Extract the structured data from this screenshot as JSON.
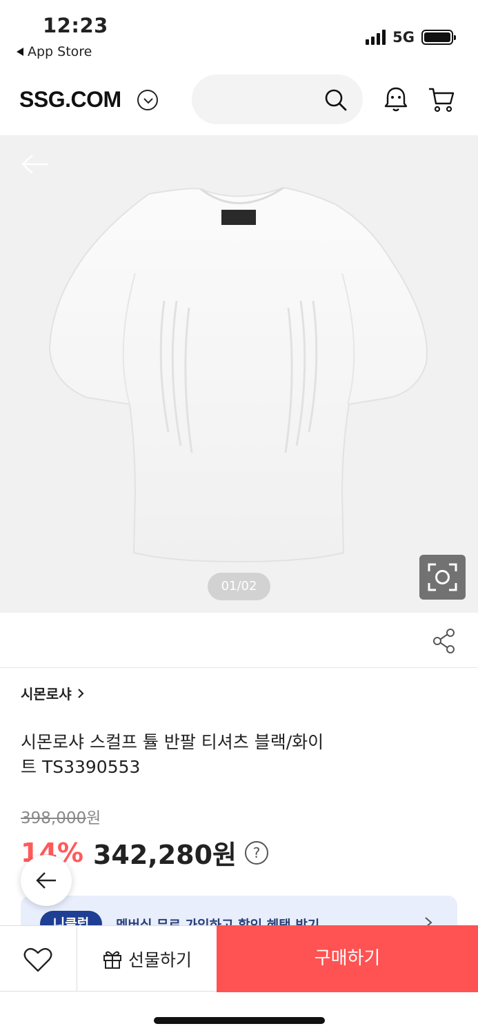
{
  "status_bar": {
    "time": "12:23",
    "back_app": "App Store",
    "network": "5G"
  },
  "header": {
    "logo": "SSG.COM",
    "icons": [
      "chevron-down-icon",
      "search-icon",
      "bell-icon",
      "cart-icon"
    ]
  },
  "gallery": {
    "page_indicator": "01/02"
  },
  "product": {
    "brand": "시몬로샤",
    "title": "시몬로샤 스컬프 튤 반팔 티셔츠 블랙/화이트 TS3390553",
    "original_price": "398,000",
    "original_currency": "원",
    "discount": "14%",
    "sale_price": "342,280원",
    "info_symbol": "?"
  },
  "banner": {
    "badge": "니클럽",
    "text": "멤버십 무료 가입하고 할인 혜택 받기"
  },
  "bottom_bar": {
    "gift_label": "선물하기",
    "buy_label": "구매하기"
  },
  "colors": {
    "accent_red": "#ff5252",
    "discount_red": "#ff5a5a",
    "banner_bg": "#e8eefc",
    "banner_badge": "#1e3f93"
  }
}
